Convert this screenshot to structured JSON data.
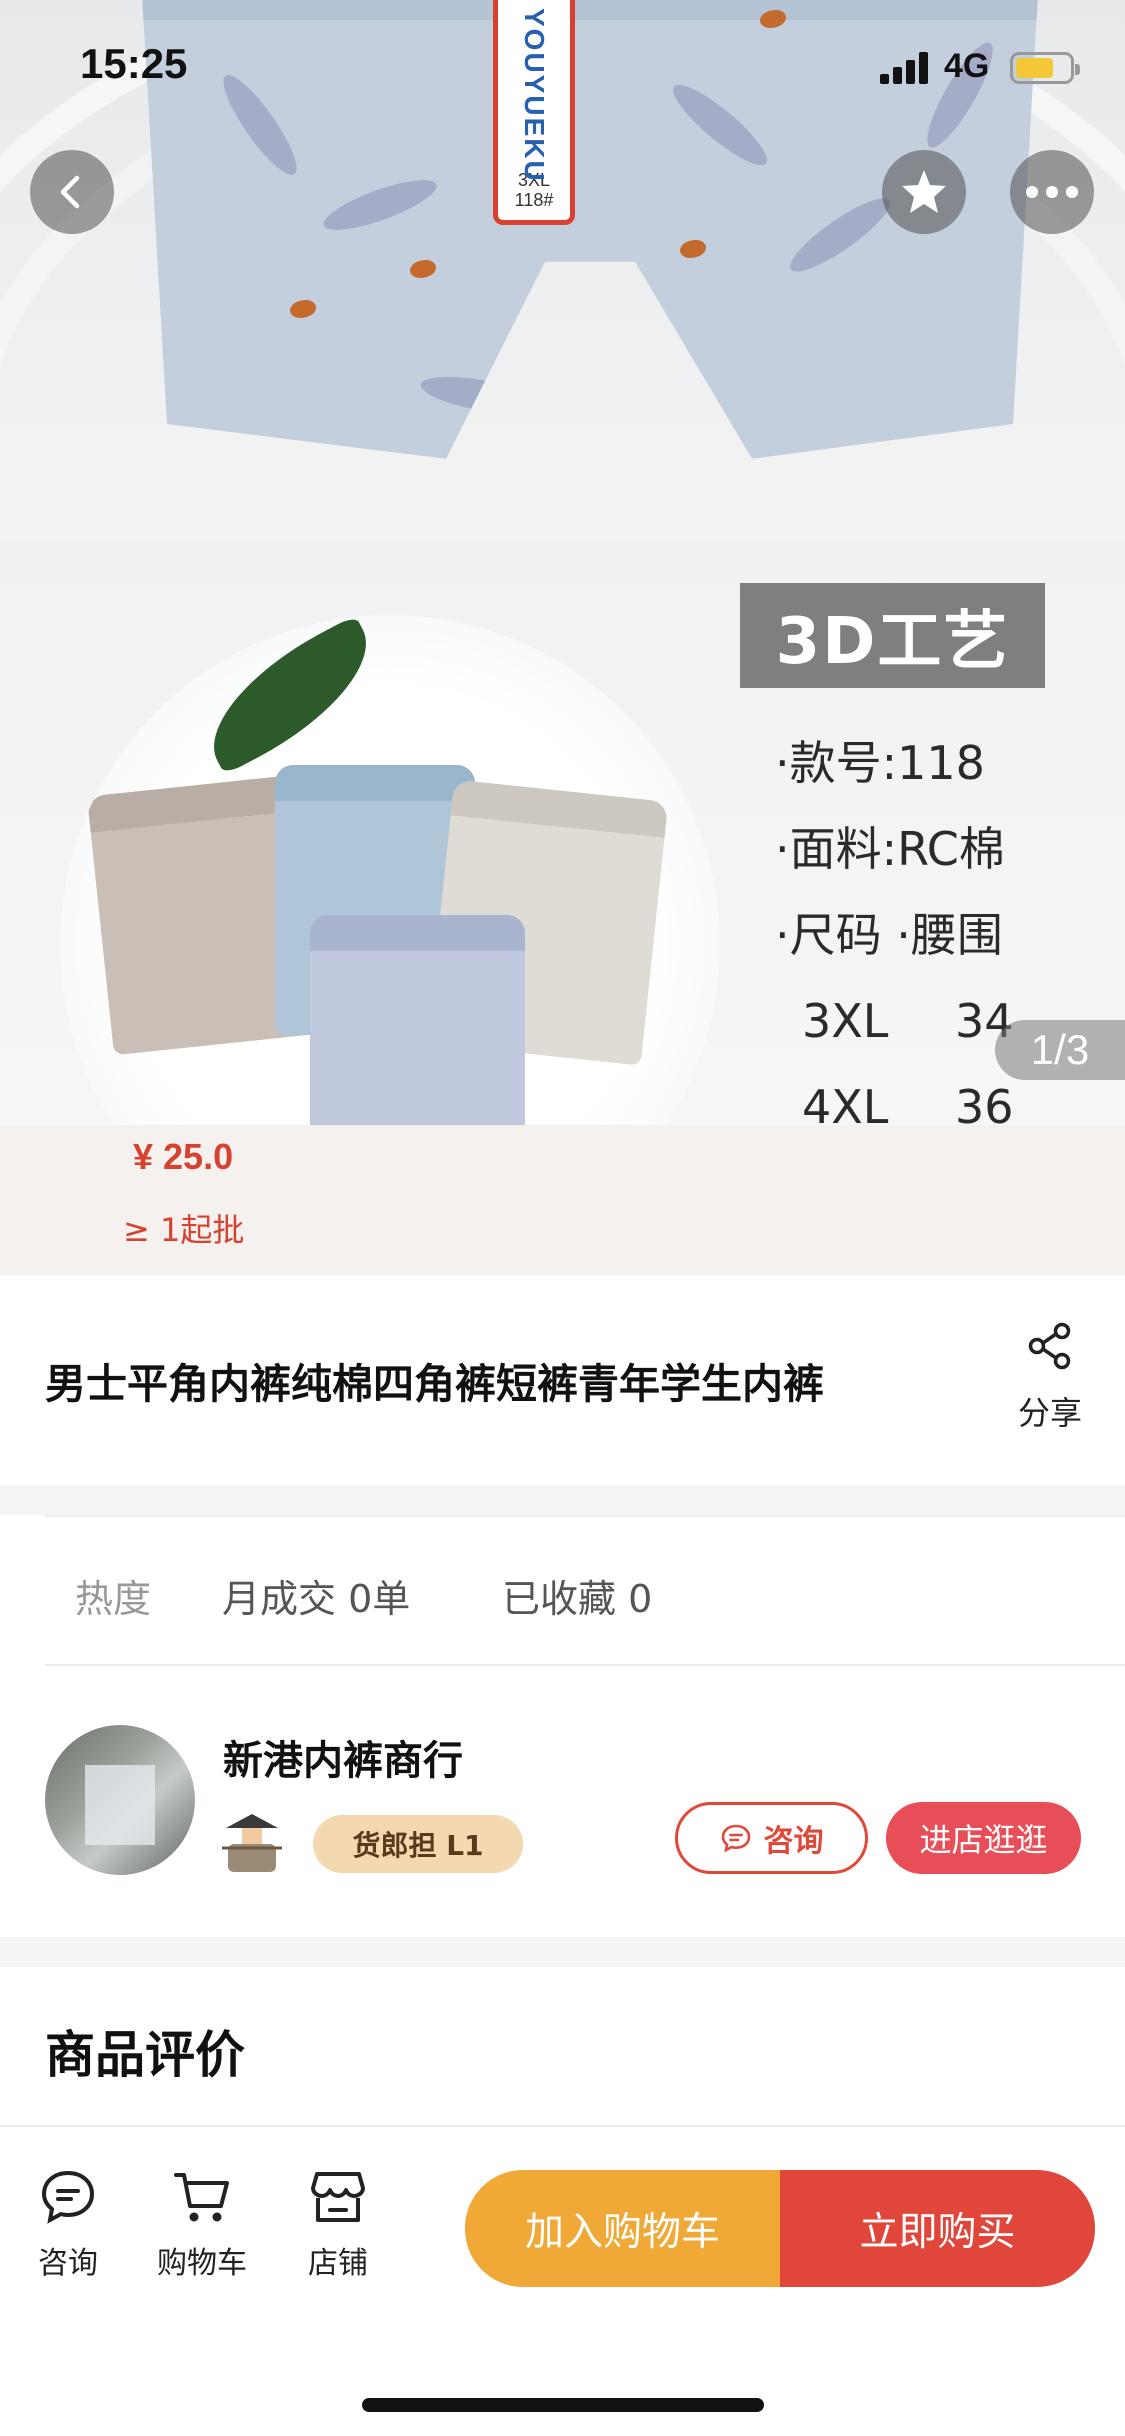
{
  "status_bar": {
    "time": "15:25",
    "network": "4G",
    "battery_level": 0.72
  },
  "hero": {
    "tag_brand": "YOUYUEKU",
    "tag_size": "3XL",
    "tag_code": "118#",
    "craft_label": "3D工艺",
    "spec_style": "·款号:118",
    "spec_fabric": "·面料:RC棉",
    "spec_size_header": "·尺码 ·腰围",
    "size_rows": [
      {
        "size": "3XL",
        "waist": "34"
      },
      {
        "size": "4XL",
        "waist": "36"
      }
    ],
    "image_counter": "1/3"
  },
  "icons": {
    "back": "chevron-left-icon",
    "favorite": "star-icon",
    "more": "more-dots-icon",
    "share": "share-icon",
    "consult": "chat-bubble-icon",
    "cart": "cart-icon",
    "store": "store-icon",
    "vendor": "vendor-avatar-icon"
  },
  "price": {
    "amount": "¥ 25.0",
    "min_batch": "≥ 1起批"
  },
  "product": {
    "title": "男士平角内裤纯棉四角裤短裤青年学生内裤",
    "share_label": "分享"
  },
  "stats": {
    "hot_label": "热度",
    "monthly": "月成交 0单",
    "favorites": "已收藏 0"
  },
  "shop": {
    "name": "新港内裤商行",
    "badge": "货郎担 L1",
    "consult_label": "咨询",
    "enter_label": "进店逛逛"
  },
  "reviews": {
    "title": "商品评价"
  },
  "bottom_bar": {
    "tabs": [
      {
        "label": "咨询"
      },
      {
        "label": "购物车"
      },
      {
        "label": "店铺"
      }
    ],
    "add_to_cart": "加入购物车",
    "buy_now": "立即购买"
  },
  "colors": {
    "accent_red": "#e0473a",
    "accent_orange": "#f0a836",
    "price_red": "#d64230",
    "badge_bg": "#f4d8b0"
  }
}
